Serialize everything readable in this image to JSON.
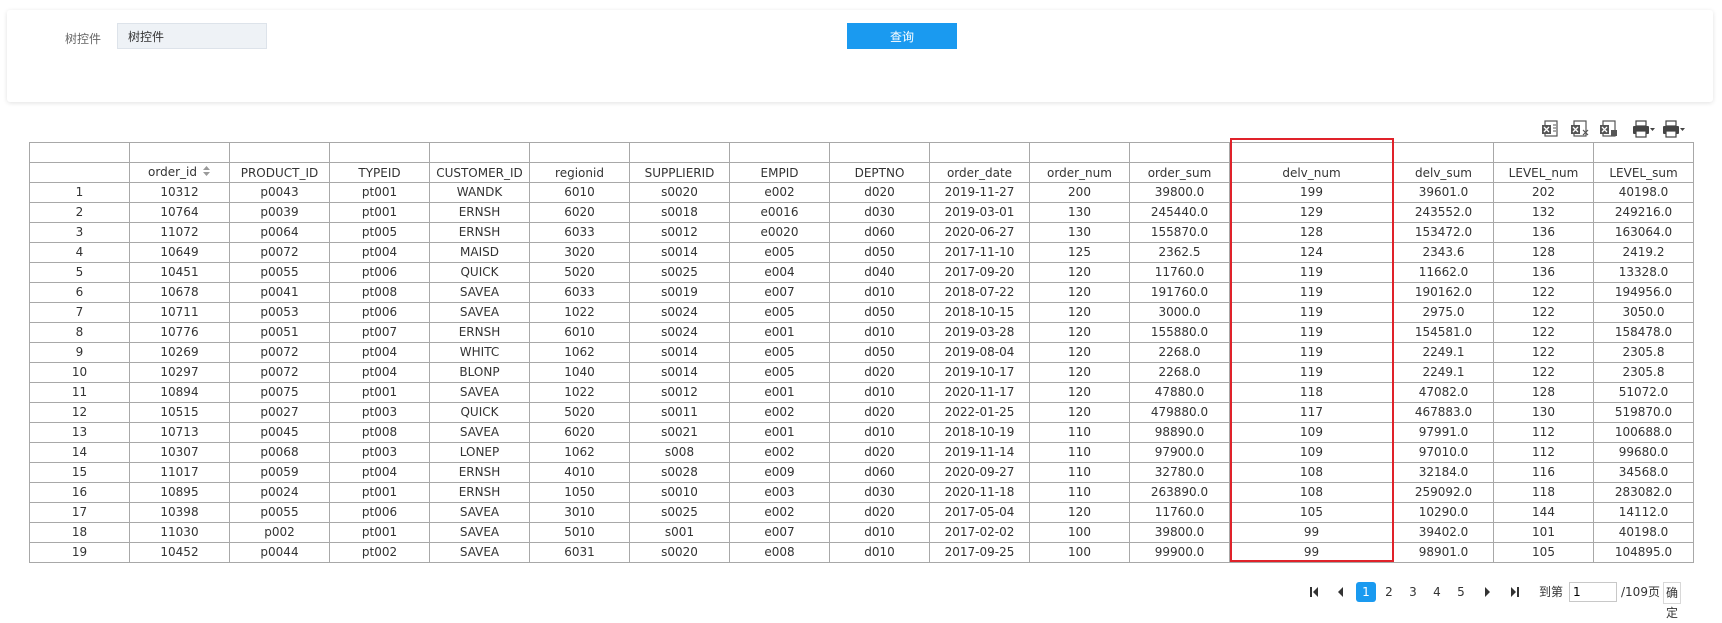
{
  "search": {
    "label": "树控件",
    "input_value": "树控件",
    "query_button": "查询"
  },
  "toolbar": {
    "icons": [
      "export-excel-icon",
      "export-excel-paged-icon",
      "export-excel-all-icon",
      "print-icon",
      "print-options-icon"
    ]
  },
  "table": {
    "columns": [
      "",
      "order_id",
      "PRODUCT_ID",
      "TYPEID",
      "CUSTOMER_ID",
      "regionid",
      "SUPPLIERID",
      "EMPID",
      "DEPTNO",
      "order_date",
      "order_num",
      "order_sum",
      "delv_num",
      "delv_sum",
      "LEVEL_num",
      "LEVEL_sum"
    ],
    "highlighted_column": "delv_num",
    "rows": [
      [
        "1",
        "10312",
        "p0043",
        "pt001",
        "WANDK",
        "6010",
        "s0020",
        "e002",
        "d020",
        "2019-11-27",
        "200",
        "39800.0",
        "199",
        "39601.0",
        "202",
        "40198.0"
      ],
      [
        "2",
        "10764",
        "p0039",
        "pt001",
        "ERNSH",
        "6020",
        "s0018",
        "e0016",
        "d030",
        "2019-03-01",
        "130",
        "245440.0",
        "129",
        "243552.0",
        "132",
        "249216.0"
      ],
      [
        "3",
        "11072",
        "p0064",
        "pt005",
        "ERNSH",
        "6033",
        "s0012",
        "e0020",
        "d060",
        "2020-06-27",
        "130",
        "155870.0",
        "128",
        "153472.0",
        "136",
        "163064.0"
      ],
      [
        "4",
        "10649",
        "p0072",
        "pt004",
        "MAISD",
        "3020",
        "s0014",
        "e005",
        "d050",
        "2017-11-10",
        "125",
        "2362.5",
        "124",
        "2343.6",
        "128",
        "2419.2"
      ],
      [
        "5",
        "10451",
        "p0055",
        "pt006",
        "QUICK",
        "5020",
        "s0025",
        "e004",
        "d040",
        "2017-09-20",
        "120",
        "11760.0",
        "119",
        "11662.0",
        "136",
        "13328.0"
      ],
      [
        "6",
        "10678",
        "p0041",
        "pt008",
        "SAVEA",
        "6033",
        "s0019",
        "e007",
        "d010",
        "2018-07-22",
        "120",
        "191760.0",
        "119",
        "190162.0",
        "122",
        "194956.0"
      ],
      [
        "7",
        "10711",
        "p0053",
        "pt006",
        "SAVEA",
        "1022",
        "s0024",
        "e005",
        "d050",
        "2018-10-15",
        "120",
        "3000.0",
        "119",
        "2975.0",
        "122",
        "3050.0"
      ],
      [
        "8",
        "10776",
        "p0051",
        "pt007",
        "ERNSH",
        "6010",
        "s0024",
        "e001",
        "d010",
        "2019-03-28",
        "120",
        "155880.0",
        "119",
        "154581.0",
        "122",
        "158478.0"
      ],
      [
        "9",
        "10269",
        "p0072",
        "pt004",
        "WHITC",
        "1062",
        "s0014",
        "e005",
        "d050",
        "2019-08-04",
        "120",
        "2268.0",
        "119",
        "2249.1",
        "122",
        "2305.8"
      ],
      [
        "10",
        "10297",
        "p0072",
        "pt004",
        "BLONP",
        "1040",
        "s0014",
        "e005",
        "d020",
        "2019-10-17",
        "120",
        "2268.0",
        "119",
        "2249.1",
        "122",
        "2305.8"
      ],
      [
        "11",
        "10894",
        "p0075",
        "pt001",
        "SAVEA",
        "1022",
        "s0012",
        "e001",
        "d010",
        "2020-11-17",
        "120",
        "47880.0",
        "118",
        "47082.0",
        "128",
        "51072.0"
      ],
      [
        "12",
        "10515",
        "p0027",
        "pt003",
        "QUICK",
        "5020",
        "s0011",
        "e002",
        "d020",
        "2022-01-25",
        "120",
        "479880.0",
        "117",
        "467883.0",
        "130",
        "519870.0"
      ],
      [
        "13",
        "10713",
        "p0045",
        "pt008",
        "SAVEA",
        "6020",
        "s0021",
        "e001",
        "d010",
        "2018-10-19",
        "110",
        "98890.0",
        "109",
        "97991.0",
        "112",
        "100688.0"
      ],
      [
        "14",
        "10307",
        "p0068",
        "pt003",
        "LONEP",
        "1062",
        "s008",
        "e002",
        "d020",
        "2019-11-14",
        "110",
        "97900.0",
        "109",
        "97010.0",
        "112",
        "99680.0"
      ],
      [
        "15",
        "11017",
        "p0059",
        "pt004",
        "ERNSH",
        "4010",
        "s0028",
        "e009",
        "d060",
        "2020-09-27",
        "110",
        "32780.0",
        "108",
        "32184.0",
        "116",
        "34568.0"
      ],
      [
        "16",
        "10895",
        "p0024",
        "pt001",
        "ERNSH",
        "1050",
        "s0010",
        "e003",
        "d030",
        "2020-11-18",
        "110",
        "263890.0",
        "108",
        "259092.0",
        "118",
        "283082.0"
      ],
      [
        "17",
        "10398",
        "p0055",
        "pt006",
        "SAVEA",
        "3010",
        "s0025",
        "e002",
        "d020",
        "2017-05-04",
        "120",
        "11760.0",
        "105",
        "10290.0",
        "144",
        "14112.0"
      ],
      [
        "18",
        "11030",
        "p002",
        "pt001",
        "SAVEA",
        "5010",
        "s001",
        "e007",
        "d010",
        "2017-02-02",
        "100",
        "39800.0",
        "99",
        "39402.0",
        "101",
        "40198.0"
      ],
      [
        "19",
        "10452",
        "p0044",
        "pt002",
        "SAVEA",
        "6031",
        "s0020",
        "e008",
        "d010",
        "2017-09-25",
        "100",
        "99900.0",
        "99",
        "98901.0",
        "105",
        "104895.0"
      ]
    ]
  },
  "pager": {
    "pages": [
      "1",
      "2",
      "3",
      "4",
      "5"
    ],
    "current_page": "1",
    "goto_label": "到第",
    "goto_value": "1",
    "total_label": "/109页",
    "confirm_label": "确定"
  },
  "colors": {
    "accent": "#1a9af0",
    "highlight": "#e0222a",
    "grid_border": "#a8a8a8"
  }
}
